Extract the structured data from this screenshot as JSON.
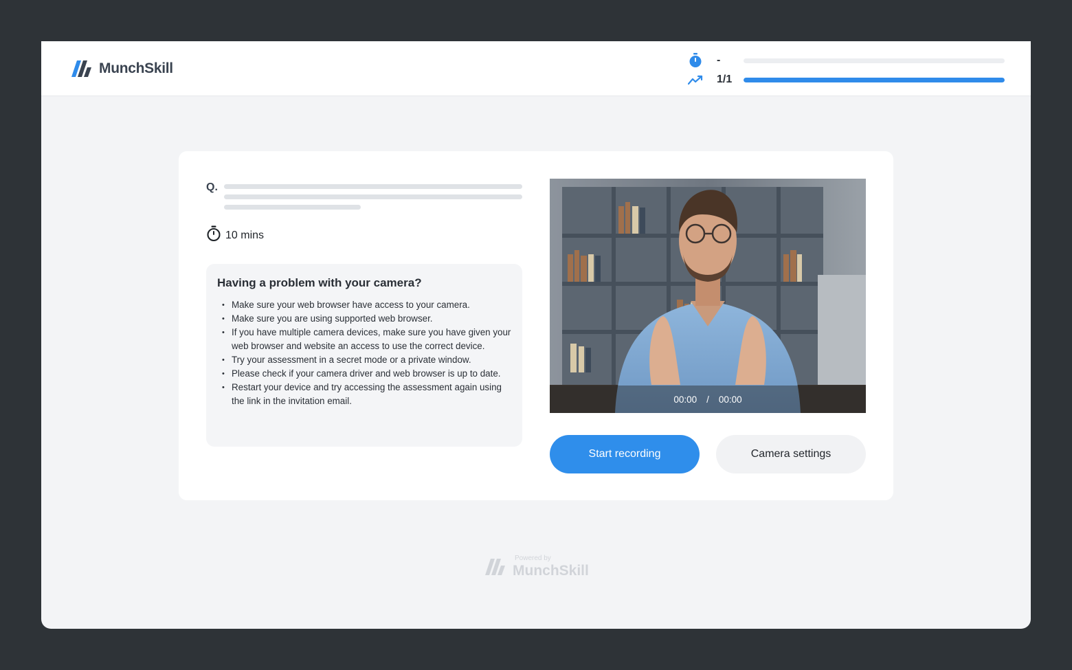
{
  "brand": {
    "name": "MunchSkill",
    "accent_color": "#2f8bea"
  },
  "progress": {
    "timer": {
      "icon": "stopwatch-icon",
      "value": "-",
      "fraction": 0
    },
    "questions": {
      "icon": "trend-line-icon",
      "value": "1/1",
      "fraction": 1.0
    }
  },
  "question": {
    "prefix": "Q.",
    "duration_icon": "stopwatch-outline-icon",
    "duration": "10 mins"
  },
  "help": {
    "title": "Having a problem with your camera?",
    "items": [
      "Make sure your web browser have access to your camera.",
      "Make sure you are using supported web browser.",
      "If you have multiple camera devices, make sure you have given your web browser and website an access to use the correct device.",
      "Try your assessment in a secret mode or a private window.",
      "Please check if your camera driver and web browser is up to date.",
      "Restart your device and try accessing the assessment again using the link in the invitation email."
    ]
  },
  "video": {
    "current_time": "00:00",
    "separator": "/",
    "total_time": "00:00"
  },
  "actions": {
    "start_label": "Start recording",
    "settings_label": "Camera settings"
  },
  "footer": {
    "powered_by": "Powered by",
    "name": "MunchSkill"
  }
}
